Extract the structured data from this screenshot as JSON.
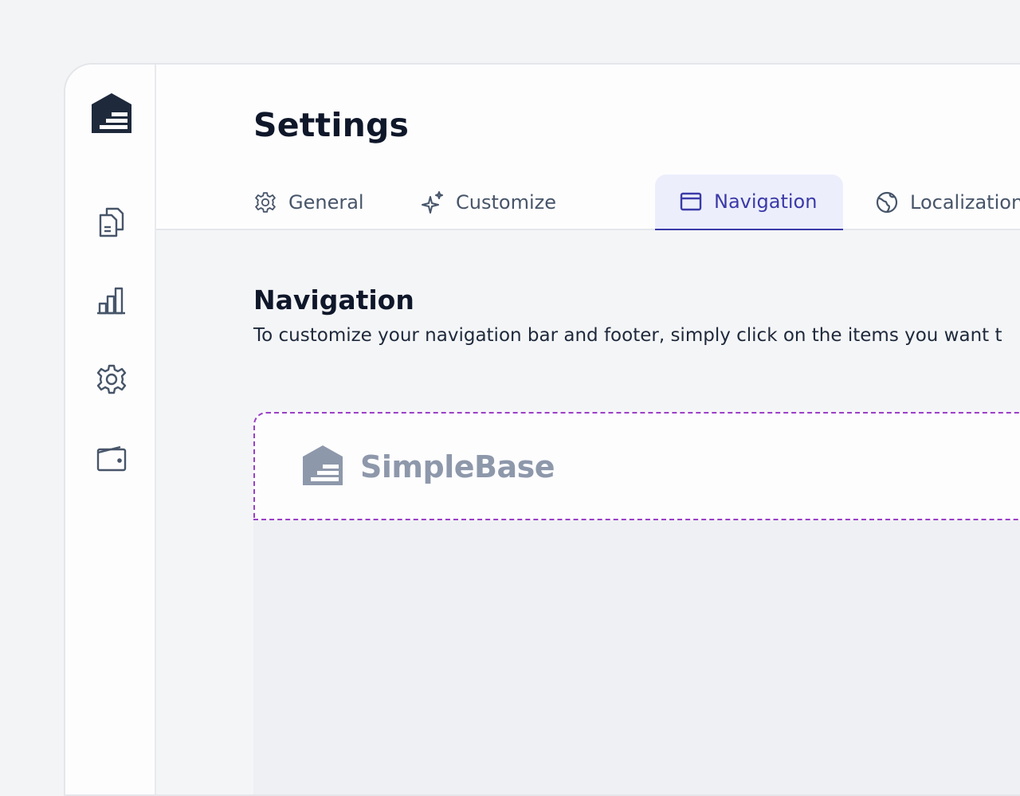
{
  "sidebar": {
    "logo_icon": "house-logo-icon",
    "items": [
      {
        "icon": "documents-icon"
      },
      {
        "icon": "bar-chart-icon"
      },
      {
        "icon": "gear-icon"
      },
      {
        "icon": "wallet-icon"
      }
    ]
  },
  "header": {
    "title": "Settings",
    "tabs": [
      {
        "label": "General",
        "icon": "gear-icon",
        "active": false
      },
      {
        "label": "Customize",
        "icon": "sparkle-icon",
        "active": false
      },
      {
        "label": "Navigation",
        "icon": "window-icon",
        "active": true
      },
      {
        "label": "Localization",
        "icon": "globe-icon",
        "active": false
      }
    ]
  },
  "content": {
    "section_title": "Navigation",
    "description": "To customize your navigation bar and footer, simply click on the items you want t"
  },
  "preview": {
    "brand_name": "SimpleBase",
    "brand_icon": "house-logo-icon"
  },
  "colors": {
    "accent": "#3b3aa8",
    "dashed_border": "#9b3fc7",
    "brand_gray": "#8e98ab",
    "logo_dark": "#1e293b"
  }
}
